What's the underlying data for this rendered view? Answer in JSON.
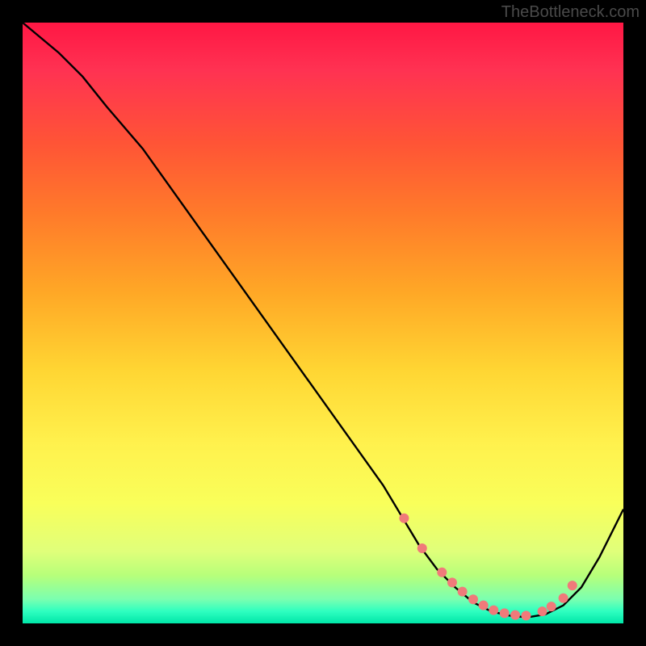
{
  "attribution": "TheBottleneck.com",
  "chart_data": {
    "type": "line",
    "title": "",
    "xlabel": "",
    "ylabel": "",
    "xlim": [
      0,
      100
    ],
    "ylim": [
      0,
      100
    ],
    "series": [
      {
        "name": "curve",
        "x": [
          0,
          6,
          10,
          14,
          20,
          25,
          30,
          35,
          40,
          45,
          50,
          55,
          60,
          63,
          66,
          69,
          72,
          75,
          78,
          81,
          84,
          87,
          90,
          93,
          96,
          100
        ],
        "y": [
          100,
          95,
          91,
          86,
          79,
          72,
          65,
          58,
          51,
          44,
          37,
          30,
          23,
          18,
          13,
          9,
          6,
          3.5,
          2,
          1.3,
          1,
          1.5,
          3,
          6,
          11,
          19
        ]
      }
    ],
    "markers": {
      "name": "highlight-dots",
      "x": [
        63.5,
        66.5,
        69.8,
        71.5,
        73.2,
        75,
        76.7,
        78.4,
        80.2,
        82,
        83.8,
        86.5,
        88,
        90,
        91.5
      ],
      "y": [
        17.5,
        12.5,
        8.5,
        6.8,
        5.3,
        4,
        3,
        2.2,
        1.7,
        1.4,
        1.3,
        2,
        2.8,
        4.2,
        6.3
      ]
    }
  }
}
